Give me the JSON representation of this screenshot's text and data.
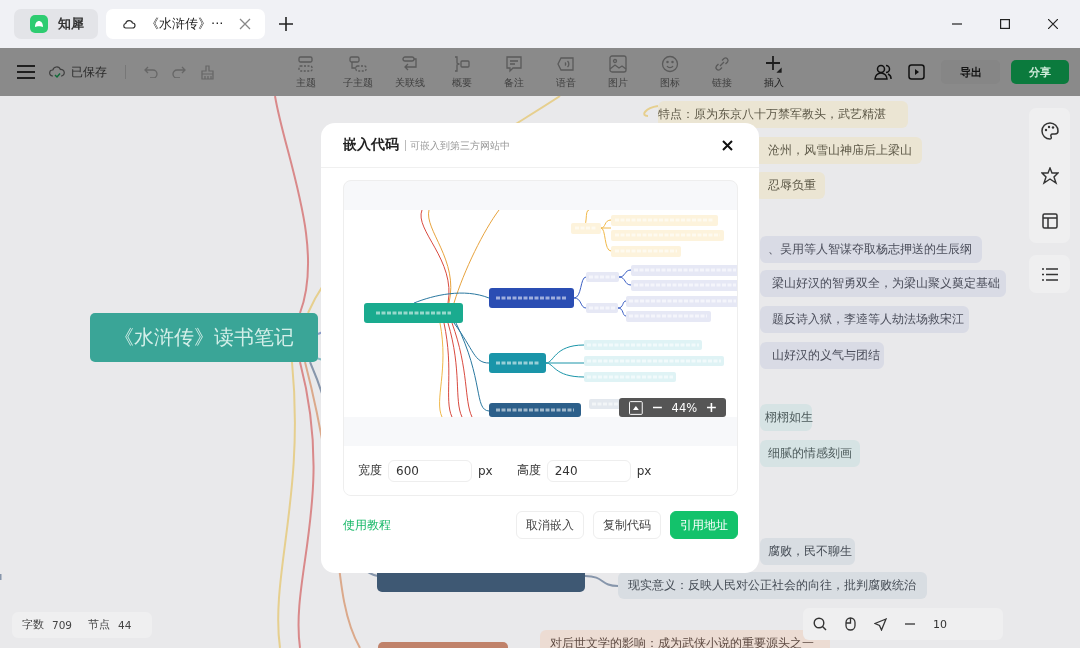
{
  "window": {
    "tabs": [
      {
        "kind": "app",
        "label": "知犀",
        "selected": false
      },
      {
        "kind": "doc",
        "label": "《水浒传》···",
        "selected": true
      }
    ]
  },
  "toolbar": {
    "save_status": "已保存",
    "tools": [
      {
        "kind": "topic",
        "label": "主题",
        "disabled": true
      },
      {
        "kind": "subtopic",
        "label": "子主题",
        "disabled": true
      },
      {
        "kind": "relation",
        "label": "关联线",
        "disabled": true
      },
      {
        "kind": "summary",
        "label": "概要",
        "disabled": true
      },
      {
        "kind": "note",
        "label": "备注",
        "disabled": true
      },
      {
        "kind": "voice",
        "label": "语音",
        "disabled": true
      },
      {
        "kind": "image",
        "label": "图片",
        "disabled": true
      },
      {
        "kind": "emoji",
        "label": "图标",
        "disabled": true
      },
      {
        "kind": "link",
        "label": "链接",
        "disabled": true
      },
      {
        "kind": "insert",
        "label": "插入",
        "disabled": false
      }
    ],
    "export": "导出",
    "share": "分享"
  },
  "canvas": {
    "root": "《水浒传》读书笔记",
    "nodes": [
      {
        "kind": "lin",
        "text": "特点：原为东京八十万禁军教头，武艺精湛"
      },
      {
        "kind": "lin",
        "text": "沧州，风雪山神庙后上梁山"
      },
      {
        "kind": "lin",
        "text": "忍辱负重"
      },
      {
        "kind": "plot",
        "text": "、吴用等人智谋夺取杨志押送的生辰纲"
      },
      {
        "kind": "plot",
        "text": "梁山好汉的智勇双全，为梁山聚义奠定基础"
      },
      {
        "kind": "plot",
        "text": "题反诗入狱，李逵等人劫法场救宋江"
      },
      {
        "kind": "plot",
        "text": "山好汉的义气与团结"
      },
      {
        "kind": "art",
        "text": "栩栩如生"
      },
      {
        "kind": "art",
        "text": "细腻的情感刻画"
      },
      {
        "kind": "history",
        "text": "腐败，民不聊生"
      },
      {
        "kind": "history",
        "text": "现实意义：反映人民对公正社会的向往，批判腐败统治"
      },
      {
        "kind": "influence",
        "text": "对后世文学的影响：成为武侠小说的重要源头之一"
      }
    ],
    "stats": [
      {
        "label": "字数",
        "value": "709"
      },
      {
        "label": "节点",
        "value": "44"
      }
    ],
    "zoom_reading": "10"
  },
  "dialog": {
    "title": "嵌入代码",
    "subtitle": "可嵌入到第三方网站中",
    "preview_zoom": "44%",
    "fields": [
      {
        "label": "宽度",
        "value": "600",
        "unit": "px"
      },
      {
        "label": "高度",
        "value": "240",
        "unit": "px"
      }
    ],
    "help_link": "使用教程",
    "buttons": [
      {
        "label": "取消嵌入",
        "primary": false
      },
      {
        "label": "复制代码",
        "primary": false
      },
      {
        "label": "引用地址",
        "primary": true
      }
    ]
  }
}
